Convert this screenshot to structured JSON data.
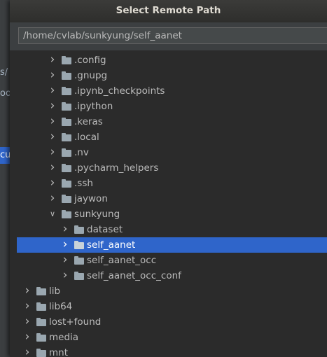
{
  "background_ide": {
    "fragments": [
      "s/",
      "oo",
      "cu"
    ]
  },
  "dialog": {
    "title": "Select Remote Path",
    "path_value": "/home/cvlab/sunkyung/self_aanet"
  },
  "tree": {
    "items": [
      {
        "label": ".config",
        "level": 3,
        "expanded": false,
        "selected": false
      },
      {
        "label": ".gnupg",
        "level": 3,
        "expanded": false,
        "selected": false
      },
      {
        "label": ".ipynb_checkpoints",
        "level": 3,
        "expanded": false,
        "selected": false
      },
      {
        "label": ".ipython",
        "level": 3,
        "expanded": false,
        "selected": false
      },
      {
        "label": ".keras",
        "level": 3,
        "expanded": false,
        "selected": false
      },
      {
        "label": ".local",
        "level": 3,
        "expanded": false,
        "selected": false
      },
      {
        "label": ".nv",
        "level": 3,
        "expanded": false,
        "selected": false
      },
      {
        "label": ".pycharm_helpers",
        "level": 3,
        "expanded": false,
        "selected": false
      },
      {
        "label": ".ssh",
        "level": 3,
        "expanded": false,
        "selected": false
      },
      {
        "label": "jaywon",
        "level": 3,
        "expanded": false,
        "selected": false
      },
      {
        "label": "sunkyung",
        "level": 3,
        "expanded": true,
        "selected": false
      },
      {
        "label": "dataset",
        "level": 4,
        "expanded": false,
        "selected": false
      },
      {
        "label": "self_aanet",
        "level": 4,
        "expanded": false,
        "selected": true
      },
      {
        "label": "self_aanet_occ",
        "level": 4,
        "expanded": false,
        "selected": false
      },
      {
        "label": "self_aanet_occ_conf",
        "level": 4,
        "expanded": false,
        "selected": false
      },
      {
        "label": "lib",
        "level": 1,
        "expanded": false,
        "selected": false
      },
      {
        "label": "lib64",
        "level": 1,
        "expanded": false,
        "selected": false
      },
      {
        "label": "lost+found",
        "level": 1,
        "expanded": false,
        "selected": false
      },
      {
        "label": "media",
        "level": 1,
        "expanded": false,
        "selected": false
      },
      {
        "label": "mnt",
        "level": 1,
        "expanded": false,
        "selected": false
      }
    ]
  },
  "colors": {
    "selection": "#2f65ca",
    "folder_icon": "#9aa7b0",
    "text": "#bbbbbb"
  },
  "icons": {
    "collapsed": "chevron-right-icon",
    "expanded": "chevron-down-icon",
    "folder": "folder-icon"
  }
}
